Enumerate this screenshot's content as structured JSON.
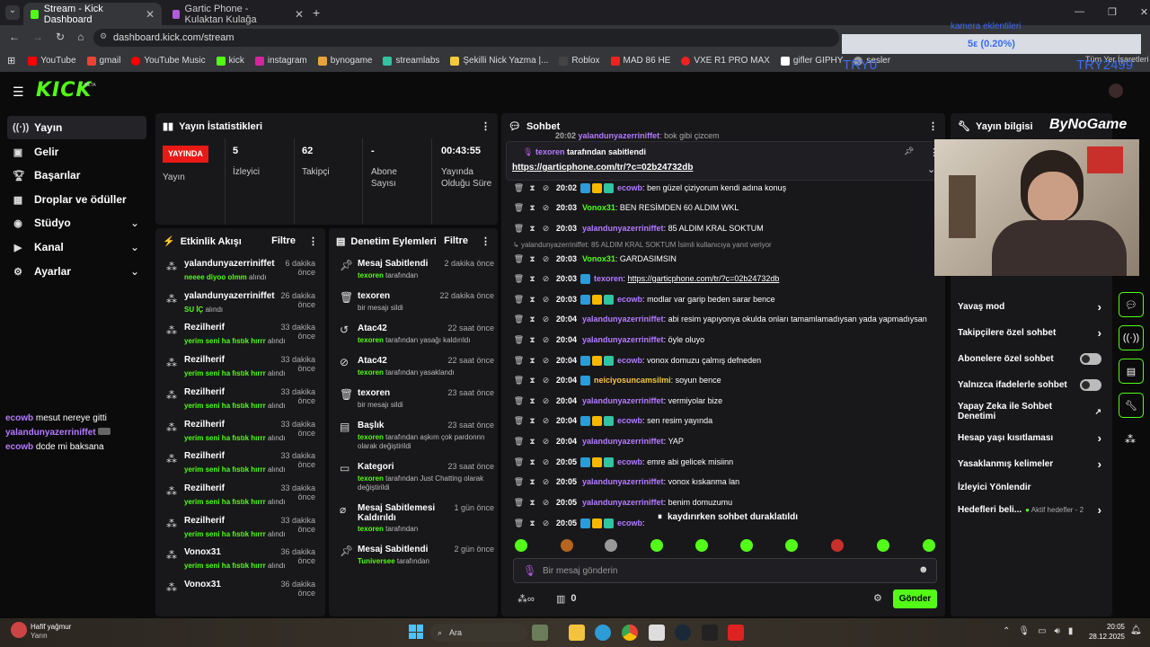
{
  "browser": {
    "tabs": [
      {
        "label": "Stream - Kick Dashboard"
      },
      {
        "label": "Gartic Phone - Kulaktan Kulağa"
      }
    ],
    "url": "dashboard.kick.com/stream",
    "bookmarks": [
      "YouTube",
      "gmail",
      "YouTube Music",
      "kick",
      "instagram",
      "bynogame",
      "streamlabs",
      "Şekilli Nick Yazma |...",
      "Roblox",
      "MAD 86 HE",
      "VXE R1 PRO MAX",
      "gifler GIPHY",
      "sesler"
    ],
    "all_bookmarks": "Tüm Yer İşaretleri"
  },
  "overlay": {
    "title": "kamera eklentileri",
    "progress_label": "5ε (0.20%)",
    "left": "TRY0",
    "right": "TRY2499"
  },
  "logo": "KICK",
  "logo_beta": "BETA",
  "sidebar": {
    "items": [
      {
        "label": "Yayın",
        "icon": "broadcast-icon"
      },
      {
        "label": "Gelir",
        "icon": "revenue-icon"
      },
      {
        "label": "Başarılar",
        "icon": "trophy-icon"
      },
      {
        "label": "Droplar ve ödüller",
        "icon": "gift-icon"
      },
      {
        "label": "Stüdyo",
        "icon": "studio-icon"
      },
      {
        "label": "Kanal",
        "icon": "channel-icon"
      },
      {
        "label": "Ayarlar",
        "icon": "gear-icon"
      }
    ]
  },
  "overlay_chat": [
    {
      "user": "ecowb",
      "msg": "mesut nereye gitti"
    },
    {
      "user": "yalandunyazerriniffet",
      "msg": ""
    },
    {
      "user": "ecowb",
      "msg": "dcde mi baksana"
    }
  ],
  "stats": {
    "title": "Yayın İstatistikleri",
    "live_badge": "YAYINDA",
    "live_label": "Yayın",
    "viewers": "5",
    "viewers_label": "İzleyici",
    "followers": "62",
    "followers_label": "Takipçi",
    "subs": "-",
    "subs_label": "Abone Sayısı",
    "duration": "00:43:55",
    "duration_label": "Yayında Olduğu Süre"
  },
  "activity": {
    "title": "Etkinlik Akışı",
    "filter": "Filtre",
    "items": [
      {
        "name": "yalandunyazerriniffet",
        "time": "6 dakika önce",
        "item": "neeee diyoo olmm",
        "suffix": "alındı"
      },
      {
        "name": "yalandunyazerriniffet",
        "time": "26 dakika önce",
        "item": "SU İÇ",
        "suffix": "alındı"
      },
      {
        "name": "Rezilherif",
        "time": "33 dakika önce",
        "item": "yerim seni ha fıstık hırrr",
        "suffix": "alındı"
      },
      {
        "name": "Rezilherif",
        "time": "33 dakika önce",
        "item": "yerim seni ha fıstık hırrr",
        "suffix": "alındı"
      },
      {
        "name": "Rezilherif",
        "time": "33 dakika önce",
        "item": "yerim seni ha fıstık hırrr",
        "suffix": "alındı"
      },
      {
        "name": "Rezilherif",
        "time": "33 dakika önce",
        "item": "yerim seni ha fıstık hırrr",
        "suffix": "alındı"
      },
      {
        "name": "Rezilherif",
        "time": "33 dakika önce",
        "item": "yerim seni ha fıstık hırrr",
        "suffix": "alındı"
      },
      {
        "name": "Rezilherif",
        "time": "33 dakika önce",
        "item": "yerim seni ha fıstık hırrr",
        "suffix": "alındı"
      },
      {
        "name": "Rezilherif",
        "time": "33 dakika önce",
        "item": "yerim seni ha fıstık hırrr",
        "suffix": "alındı"
      },
      {
        "name": "Vonox31",
        "time": "36 dakika önce",
        "item": "yerim seni ha fıstık hırrr",
        "suffix": "alındı"
      },
      {
        "name": "Vonox31",
        "time": "36 dakika önce",
        "item": "",
        "suffix": ""
      }
    ]
  },
  "mod": {
    "title": "Denetim Eylemleri",
    "filter": "Filtre",
    "items": [
      {
        "name": "Mesaj Sabitlendi",
        "time": "2 dakika önce",
        "user": "texoren",
        "rest": "tarafından"
      },
      {
        "name": "texoren",
        "time": "22 dakika önce",
        "user": "",
        "rest": "bir mesajı sildi"
      },
      {
        "name": "Atac42",
        "time": "22 saat önce",
        "user": "texoren",
        "rest": "tarafından yasağı kaldırıldı"
      },
      {
        "name": "Atac42",
        "time": "22 saat önce",
        "user": "texoren",
        "rest": "tarafından yasaklandı"
      },
      {
        "name": "texoren",
        "time": "23 saat önce",
        "user": "",
        "rest": "bir mesajı sildi"
      },
      {
        "name": "Başlık",
        "time": "23 saat önce",
        "user": "texoren",
        "rest": "tarafından aşkım çok pardonnn olarak değiştirildi"
      },
      {
        "name": "Kategori",
        "time": "23 saat önce",
        "user": "texoren",
        "rest": "tarafından Just Chatting olarak değiştirildi"
      },
      {
        "name": "Mesaj Sabitlemesi Kaldırıldı",
        "time": "1 gün önce",
        "user": "texoren",
        "rest": "tarafından"
      },
      {
        "name": "Mesaj Sabitlendi",
        "time": "2 gün önce",
        "user": "Tuniversee",
        "rest": "tarafından"
      }
    ]
  },
  "chat": {
    "title": "Sohbet",
    "pinned_by": "texoren",
    "pinned_suffix": "tarafından sabitlendi",
    "pinned_link": "https://garticphone.com/tr/?c=02b24732db",
    "top_fragment_time": "20:02",
    "top_fragment_user": "yalandunyazerriniffet",
    "top_fragment_msg": "bok gibi çizcem",
    "reply_notice": "yalandunyazerriniffet: 85 ALDIM KRAL SOKTUM İsimli kullanıcıya yanıt veriyor",
    "messages": [
      {
        "time": "20:02",
        "user": "ecowb",
        "color": "#b57bff",
        "msg": "ben güzel çiziyorum kendi adına konuş",
        "badges": 3
      },
      {
        "time": "20:03",
        "user": "Vonox31",
        "color": "#53fc18",
        "msg": "BEN RESİMDEN 60 ALDIM WKL",
        "badges": 0
      },
      {
        "time": "20:03",
        "user": "yalandunyazerriniffet",
        "color": "#b57bff",
        "msg": "85 ALDIM KRAL SOKTUM",
        "badges": 0
      },
      {
        "time": "20:03",
        "user": "Vonox31",
        "color": "#53fc18",
        "msg": "GARDASIMSIN",
        "badges": 0
      },
      {
        "time": "20:03",
        "user": "texoren",
        "color": "#b57bff",
        "msg": "https://garticphone.com/tr/?c=02b24732db",
        "badges": 1
      },
      {
        "time": "20:03",
        "user": "ecowb",
        "color": "#b57bff",
        "msg": "modlar var garip beden sarar bence",
        "badges": 3
      },
      {
        "time": "20:04",
        "user": "yalandunyazerriniffet",
        "color": "#b57bff",
        "msg": "abi resim yapıyonya okulda onları tamamlamadıysan yada yapmadıysan",
        "badges": 0
      },
      {
        "time": "20:04",
        "user": "yalandunyazerriniffet",
        "color": "#b57bff",
        "msg": "öyle oluyo",
        "badges": 0
      },
      {
        "time": "20:04",
        "user": "ecowb",
        "color": "#b57bff",
        "msg": "vonox domuzu çalmış defneden",
        "badges": 3
      },
      {
        "time": "20:04",
        "user": "neiciyosuncamsilmi",
        "color": "#f5c842",
        "msg": "soyun bence",
        "badges": 1
      },
      {
        "time": "20:04",
        "user": "yalandunyazerriniffet",
        "color": "#b57bff",
        "msg": "vermiyolar bize",
        "badges": 0
      },
      {
        "time": "20:04",
        "user": "ecowb",
        "color": "#b57bff",
        "msg": "sen resim yayında",
        "badges": 3
      },
      {
        "time": "20:04",
        "user": "yalandunyazerriniffet",
        "color": "#b57bff",
        "msg": "YAP",
        "badges": 0
      },
      {
        "time": "20:05",
        "user": "ecowb",
        "color": "#b57bff",
        "msg": "emre abi gelicek misiinn",
        "badges": 3
      },
      {
        "time": "20:05",
        "user": "yalandunyazerriniffet",
        "color": "#b57bff",
        "msg": "vonox kıskanma lan",
        "badges": 0
      },
      {
        "time": "20:05",
        "user": "yalandunyazerriniffet",
        "color": "#b57bff",
        "msg": "benim domuzumu",
        "badges": 0
      },
      {
        "time": "20:05",
        "user": "ecowb",
        "color": "#b57bff",
        "msg": "",
        "badges": 3
      }
    ],
    "paused": "kaydırırken sohbet duraklatıldı",
    "input_placeholder": "Bir mesaj gönderin",
    "points": "0",
    "send": "Gönder"
  },
  "info": {
    "title": "Yayın bilgisi",
    "brand": "ByNoGame",
    "items": [
      {
        "label": "Yavaş mod",
        "ctrl": "arrow"
      },
      {
        "label": "Takipçilere özel sohbet",
        "ctrl": "arrow"
      },
      {
        "label": "Abonelere özel sohbet",
        "ctrl": "toggle"
      },
      {
        "label": "Yalnızca ifadelerle sohbet",
        "ctrl": "toggle"
      },
      {
        "label": "Yapay Zeka ile Sohbet Denetimi",
        "ctrl": "ext"
      },
      {
        "label": "Hesap yaşı kısıtlaması",
        "ctrl": "arrow"
      },
      {
        "label": "Yasaklanmış kelimeler",
        "ctrl": "arrow"
      },
      {
        "label": "İzleyici Yönlendir",
        "ctrl": "none"
      },
      {
        "label": "Hedefleri beli...",
        "ctrl": "arrow",
        "extra": "Aktif hedefler - 2"
      }
    ]
  },
  "taskbar": {
    "weather": "Hafif yağmur",
    "weather_sub": "Yarın",
    "search": "Ara",
    "time": "20:05",
    "date": "28.12.2025"
  },
  "colors": {
    "accent": "#53fc18",
    "live": "#e91916",
    "bg": "#0b0b0b",
    "panel": "#18181b"
  }
}
